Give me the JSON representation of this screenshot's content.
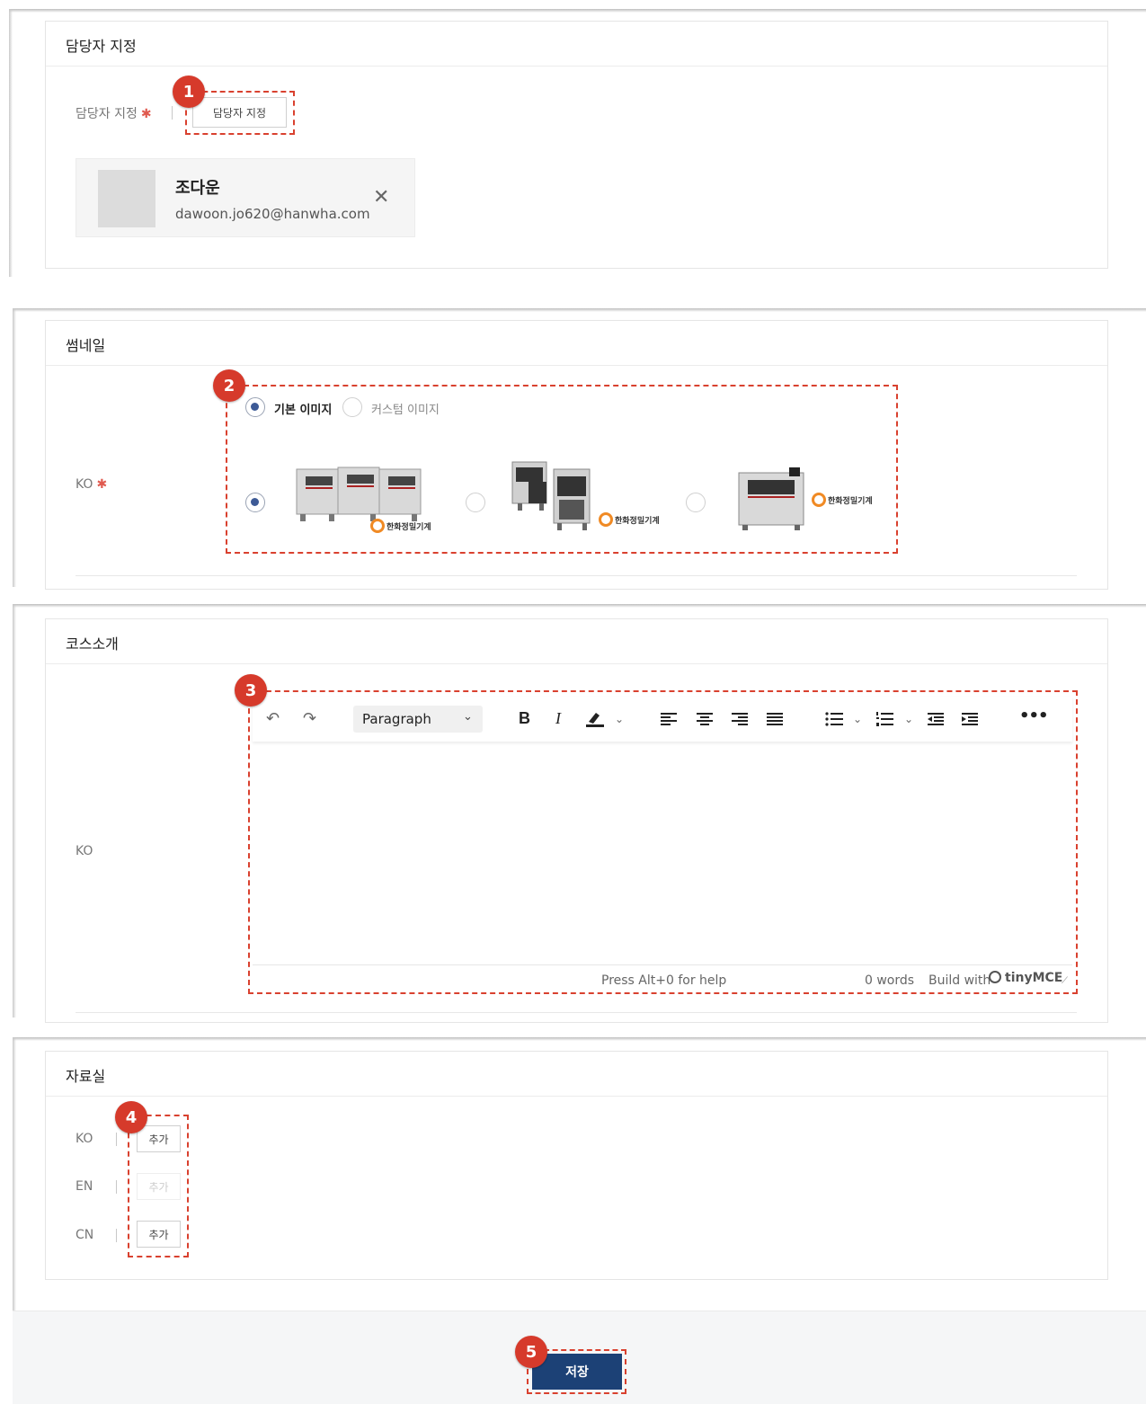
{
  "assignee_section": {
    "title": "담당자 지정",
    "field_label": "담당자 지정",
    "assign_button": "담당자 지정",
    "person": {
      "name": "조다운",
      "email": "dawoon.jo620@hanwha.com"
    }
  },
  "thumbnail_section": {
    "title": "썸네일",
    "lang_label": "KO",
    "options": [
      "기본 이미지",
      "커스텀 이미지"
    ],
    "selected_option": "기본 이미지",
    "images": [
      {
        "logo_text": "한화정밀기계",
        "selected": true
      },
      {
        "logo_text": "한화정밀기계",
        "selected": false
      },
      {
        "logo_text": "한화정밀기계",
        "selected": false
      }
    ]
  },
  "course_intro_section": {
    "title": "코스소개",
    "lang_label": "KO",
    "editor": {
      "block_format": "Paragraph",
      "help_text": "Press Alt+0 for help",
      "word_count": "0 words",
      "brand_text": "Build with",
      "brand_name": "tinyMCE"
    }
  },
  "materials_section": {
    "title": "자료실",
    "rows": [
      {
        "lang": "KO",
        "button": "추가",
        "disabled": false
      },
      {
        "lang": "EN",
        "button": "추가",
        "disabled": true
      },
      {
        "lang": "CN",
        "button": "추가",
        "disabled": false
      }
    ]
  },
  "footer": {
    "save_button": "저장"
  },
  "badges": [
    "1",
    "2",
    "3",
    "4",
    "5"
  ],
  "colors": {
    "annotation": "#d63a2b",
    "primary": "#1c4176",
    "required": "#e05a4f"
  }
}
